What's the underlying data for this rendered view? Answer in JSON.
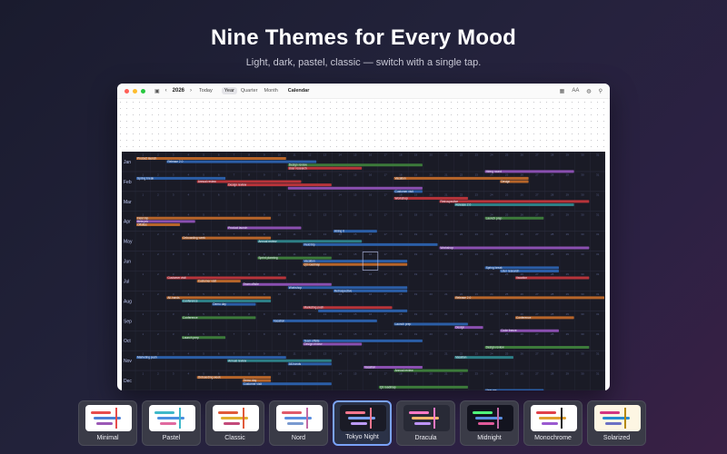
{
  "headline": "Nine Themes for Every Mood",
  "subheadline": "Light, dark, pastel, classic — switch with a single tap.",
  "toolbar": {
    "year": "2026",
    "today_label": "Today",
    "view_modes": [
      "Year",
      "Quarter",
      "Month"
    ],
    "active_view": "Year",
    "title": "Calendar",
    "text_size_icon_label": "AA"
  },
  "calendar": {
    "months": [
      "Jan",
      "Feb",
      "Mar",
      "Apr",
      "May",
      "Jun",
      "Jul",
      "Aug",
      "Sep",
      "Oct",
      "Nov",
      "Dec"
    ],
    "palette": {
      "background": "#1a1b26",
      "grid": "#2a2c3d",
      "day_number": "#565f89",
      "month_label": "#c0caf5",
      "event_text": "#e6e9f5",
      "orange": "#b7652a",
      "purple": "#8a4fb0",
      "red": "#b7343a",
      "blue": "#2b5ea7",
      "green": "#3c7a3a",
      "teal": "#2d7f86"
    },
    "events": [
      {
        "row": 0,
        "start": 0,
        "end": 9,
        "color": "orange",
        "label": "Product launch"
      },
      {
        "row": 0,
        "start": 2,
        "end": 11,
        "color": "blue",
        "label": "Release 2.0"
      },
      {
        "row": 0,
        "start": 10,
        "end": 18,
        "color": "green",
        "label": "Design review"
      },
      {
        "row": 0,
        "start": 10,
        "end": 14,
        "color": "red",
        "label": "User research"
      },
      {
        "row": 0,
        "start": 23,
        "end": 28,
        "color": "purple",
        "label": "Hiring round"
      },
      {
        "row": 1,
        "start": 0,
        "end": 5,
        "color": "blue",
        "label": "Spring break"
      },
      {
        "row": 1,
        "start": 4,
        "end": 10,
        "color": "red",
        "label": "Annual review"
      },
      {
        "row": 1,
        "start": 6,
        "end": 12,
        "color": "red",
        "label": "Design review"
      },
      {
        "row": 1,
        "start": 10,
        "end": 18,
        "color": "purple",
        "label": ""
      },
      {
        "row": 1,
        "start": 17,
        "end": 18,
        "color": "blue",
        "label": "Customer visit"
      },
      {
        "row": 1,
        "start": 17,
        "end": 25,
        "color": "orange",
        "label": "Vacation"
      },
      {
        "row": 1,
        "start": 24,
        "end": 25,
        "color": "orange",
        "label": "Design"
      },
      {
        "row": 2,
        "start": 17,
        "end": 21,
        "color": "red",
        "label": "Workshop"
      },
      {
        "row": 2,
        "start": 20,
        "end": 29,
        "color": "red",
        "label": "Retrospective"
      },
      {
        "row": 2,
        "start": 21,
        "end": 28,
        "color": "teal",
        "label": "Release 2.0"
      },
      {
        "row": 3,
        "start": 0,
        "end": 8,
        "color": "orange",
        "label": "Field trip"
      },
      {
        "row": 3,
        "start": 0,
        "end": 3,
        "color": "purple",
        "label": "Beta pro"
      },
      {
        "row": 3,
        "start": 0,
        "end": 2,
        "color": "orange",
        "label": "Offsites"
      },
      {
        "row": 3,
        "start": 6,
        "end": 10,
        "color": "purple",
        "label": "Product launch"
      },
      {
        "row": 3,
        "start": 13,
        "end": 15,
        "color": "blue",
        "label": "Hiring it"
      },
      {
        "row": 3,
        "start": 23,
        "end": 26,
        "color": "green",
        "label": "Launch prep"
      },
      {
        "row": 4,
        "start": 3,
        "end": 8,
        "color": "orange",
        "label": "Onboarding week"
      },
      {
        "row": 4,
        "start": 8,
        "end": 14,
        "color": "teal",
        "label": "Annual review"
      },
      {
        "row": 4,
        "start": 11,
        "end": 19,
        "color": "blue",
        "label": "Field trip"
      },
      {
        "row": 4,
        "start": 20,
        "end": 29,
        "color": "purple",
        "label": "Workshop"
      },
      {
        "row": 5,
        "start": 8,
        "end": 12,
        "color": "green",
        "label": "Sprint planning"
      },
      {
        "row": 5,
        "start": 11,
        "end": 17,
        "color": "blue",
        "label": "Vacation"
      },
      {
        "row": 5,
        "start": 11,
        "end": 17,
        "color": "orange",
        "label": "Q3 roadmap"
      },
      {
        "row": 5,
        "start": 23,
        "end": 27,
        "color": "blue",
        "label": "Spring break"
      },
      {
        "row": 5,
        "start": 24,
        "end": 27,
        "color": "blue",
        "label": "User research"
      },
      {
        "row": 6,
        "start": 2,
        "end": 9,
        "color": "red",
        "label": "Customer visit"
      },
      {
        "row": 6,
        "start": 4,
        "end": 6,
        "color": "orange",
        "label": "Customer visit"
      },
      {
        "row": 6,
        "start": 7,
        "end": 12,
        "color": "purple",
        "label": "Team offsite"
      },
      {
        "row": 6,
        "start": 10,
        "end": 17,
        "color": "blue",
        "label": "Workshop"
      },
      {
        "row": 6,
        "start": 13,
        "end": 17,
        "color": "blue",
        "label": "Retrospective"
      },
      {
        "row": 6,
        "start": 25,
        "end": 29,
        "color": "red",
        "label": "Vacation"
      },
      {
        "row": 7,
        "start": 2,
        "end": 8,
        "color": "orange",
        "label": "All-hands"
      },
      {
        "row": 7,
        "start": 3,
        "end": 8,
        "color": "teal",
        "label": "Conference"
      },
      {
        "row": 7,
        "start": 5,
        "end": 7,
        "color": "blue",
        "label": "Demo day"
      },
      {
        "row": 7,
        "start": 11,
        "end": 16,
        "color": "red",
        "label": "Marketing push"
      },
      {
        "row": 7,
        "start": 12,
        "end": 17,
        "color": "blue",
        "label": ""
      },
      {
        "row": 7,
        "start": 21,
        "end": 30,
        "color": "orange",
        "label": "Release 2.0"
      },
      {
        "row": 8,
        "start": 3,
        "end": 7,
        "color": "green",
        "label": "Conference"
      },
      {
        "row": 8,
        "start": 9,
        "end": 15,
        "color": "blue",
        "label": "Vacation"
      },
      {
        "row": 8,
        "start": 17,
        "end": 21,
        "color": "blue",
        "label": "Launch prep"
      },
      {
        "row": 8,
        "start": 21,
        "end": 22,
        "color": "purple",
        "label": "Design"
      },
      {
        "row": 8,
        "start": 24,
        "end": 27,
        "color": "purple",
        "label": "Code freeze"
      },
      {
        "row": 8,
        "start": 25,
        "end": 28,
        "color": "orange",
        "label": "Conference"
      },
      {
        "row": 9,
        "start": 3,
        "end": 5,
        "color": "green",
        "label": "Launch prep"
      },
      {
        "row": 9,
        "start": 11,
        "end": 18,
        "color": "blue",
        "label": "Team offsite"
      },
      {
        "row": 9,
        "start": 11,
        "end": 14,
        "color": "purple",
        "label": "Design review"
      },
      {
        "row": 9,
        "start": 23,
        "end": 29,
        "color": "green",
        "label": "Design review"
      },
      {
        "row": 10,
        "start": 0,
        "end": 9,
        "color": "blue",
        "label": "Marketing push"
      },
      {
        "row": 10,
        "start": 6,
        "end": 12,
        "color": "teal",
        "label": "Annual review"
      },
      {
        "row": 10,
        "start": 10,
        "end": 12,
        "color": "blue",
        "label": "All-hands"
      },
      {
        "row": 10,
        "start": 15,
        "end": 18,
        "color": "purple",
        "label": "Vacation"
      },
      {
        "row": 10,
        "start": 17,
        "end": 21,
        "color": "green",
        "label": "Annual review"
      },
      {
        "row": 10,
        "start": 21,
        "end": 24,
        "color": "teal",
        "label": "Vacation"
      },
      {
        "row": 11,
        "start": 4,
        "end": 8,
        "color": "orange",
        "label": "Onboarding week"
      },
      {
        "row": 11,
        "start": 7,
        "end": 8,
        "color": "orange",
        "label": "Demo day"
      },
      {
        "row": 11,
        "start": 7,
        "end": 12,
        "color": "blue",
        "label": "Customer visit"
      },
      {
        "row": 11,
        "start": 16,
        "end": 21,
        "color": "green",
        "label": "Q3 roadmap"
      },
      {
        "row": 11,
        "start": 23,
        "end": 26,
        "color": "blue",
        "label": "User res"
      }
    ]
  },
  "themes": [
    {
      "name": "Minimal",
      "selected": false,
      "bg": "#ffffff",
      "bars": [
        "#e74c4c",
        "#4a7fd6",
        "#9b59b6"
      ],
      "accent": "#e74c4c"
    },
    {
      "name": "Pastel",
      "selected": false,
      "bg": "#ffffff",
      "bars": [
        "#3fb8c9",
        "#4a8fe0",
        "#e06aa0"
      ],
      "accent": "#3fb8c9"
    },
    {
      "name": "Classic",
      "selected": false,
      "bg": "#ffffff",
      "bars": [
        "#e05a3a",
        "#e0b030",
        "#c34a7a"
      ],
      "accent": "#e05a3a"
    },
    {
      "name": "Nord",
      "selected": false,
      "bg": "#ffffff",
      "bars": [
        "#e05a6a",
        "#5a8ee0",
        "#7a9ad0"
      ],
      "accent": "#c26aa6"
    },
    {
      "name": "Tokyo Night",
      "selected": true,
      "bg": "#1a1b26",
      "bars": [
        "#f7768e",
        "#7aa2f7",
        "#bb9af7"
      ],
      "accent": "#f7768e"
    },
    {
      "name": "Dracula",
      "selected": false,
      "bg": "#282a36",
      "bars": [
        "#ff79c6",
        "#ffb86c",
        "#bd93f9"
      ],
      "accent": "#ff79c6"
    },
    {
      "name": "Midnight",
      "selected": false,
      "bg": "#13141f",
      "bars": [
        "#50fa7b",
        "#5a8ee0",
        "#e05a9a"
      ],
      "accent": "#c26aa6"
    },
    {
      "name": "Monochrome",
      "selected": false,
      "bg": "#ffffff",
      "bars": [
        "#e0404a",
        "#e0a030",
        "#9a5ad0"
      ],
      "accent": "#222222"
    },
    {
      "name": "Solarized",
      "selected": false,
      "bg": "#fdf6e3",
      "bars": [
        "#d33682",
        "#268bd2",
        "#6c71c4"
      ],
      "accent": "#b58900"
    }
  ]
}
